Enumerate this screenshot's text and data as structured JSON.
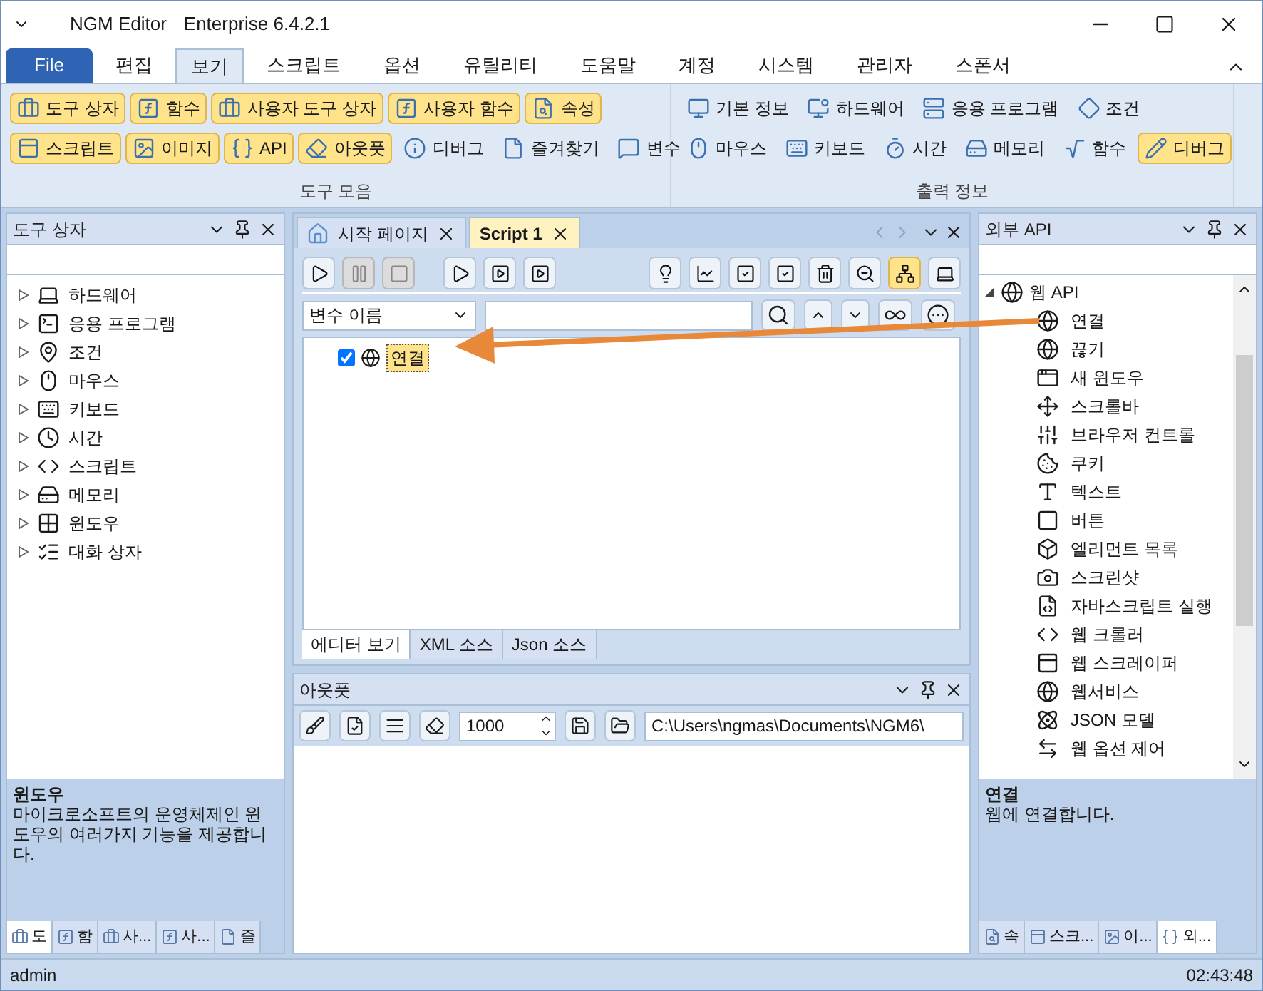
{
  "window": {
    "title": "NGM Editor",
    "edition": "Enterprise 6.4.2.1"
  },
  "menu_tabs": [
    {
      "label": "File",
      "kind": "file",
      "selected": false
    },
    {
      "label": "편집",
      "kind": "tab",
      "selected": false
    },
    {
      "label": "보기",
      "kind": "tab",
      "selected": true
    },
    {
      "label": "스크립트",
      "kind": "tab",
      "selected": false
    },
    {
      "label": "옵션",
      "kind": "tab",
      "selected": false
    },
    {
      "label": "유틸리티",
      "kind": "tab",
      "selected": false
    },
    {
      "label": "도움말",
      "kind": "tab",
      "selected": false
    },
    {
      "label": "계정",
      "kind": "tab",
      "selected": false
    },
    {
      "label": "시스템",
      "kind": "tab",
      "selected": false
    },
    {
      "label": "관리자",
      "kind": "tab",
      "selected": false
    },
    {
      "label": "스폰서",
      "kind": "tab",
      "selected": false
    }
  ],
  "ribbon": {
    "groups": [
      {
        "title": "도구 모음",
        "rows": [
          {
            "items": [
              {
                "label": "도구 상자",
                "active": true
              },
              {
                "label": "함수",
                "active": true
              },
              {
                "label": "사용자 도구 상자",
                "active": true
              },
              {
                "label": "사용자 함수",
                "active": true
              },
              {
                "label": "속성",
                "active": true
              }
            ]
          },
          {
            "items": [
              {
                "label": "스크립트",
                "active": true
              },
              {
                "label": "이미지",
                "active": true
              },
              {
                "label": "API",
                "active": true
              },
              {
                "label": "아웃풋",
                "active": true
              },
              {
                "label": "디버그",
                "active": false
              },
              {
                "label": "즐겨찾기",
                "active": false
              },
              {
                "label": "변수",
                "active": false
              }
            ]
          }
        ]
      },
      {
        "title": "출력 정보",
        "rows": [
          {
            "items": [
              {
                "label": "기본 정보",
                "active": false
              },
              {
                "label": "하드웨어",
                "active": false
              },
              {
                "label": "응용 프로그램",
                "active": false
              },
              {
                "label": "조건",
                "active": false
              }
            ]
          },
          {
            "items": [
              {
                "label": "마우스",
                "active": false
              },
              {
                "label": "키보드",
                "active": false
              },
              {
                "label": "시간",
                "active": false
              },
              {
                "label": "메모리",
                "active": false
              },
              {
                "label": "함수",
                "active": false
              },
              {
                "label": "디버그",
                "active": true
              }
            ]
          }
        ]
      }
    ]
  },
  "toolbox": {
    "title": "도구 상자",
    "items": [
      {
        "label": "하드웨어",
        "expanded": false
      },
      {
        "label": "응용 프로그램",
        "expanded": false
      },
      {
        "label": "조건",
        "expanded": false
      },
      {
        "label": "마우스",
        "expanded": false
      },
      {
        "label": "키보드",
        "expanded": false
      },
      {
        "label": "시간",
        "expanded": false
      },
      {
        "label": "스크립트",
        "expanded": false
      },
      {
        "label": "메모리",
        "expanded": false
      },
      {
        "label": "윈도우",
        "expanded": false
      },
      {
        "label": "대화 상자",
        "expanded": false
      }
    ],
    "description": {
      "title": "윈도우",
      "text": "마이크로소프트의 운영체제인 윈도우의 여러가지 기능을 제공합니다."
    },
    "tabs": [
      {
        "label": "도",
        "selected": true
      },
      {
        "label": "함",
        "selected": false
      },
      {
        "label": "사...",
        "selected": false
      },
      {
        "label": "사...",
        "selected": false
      },
      {
        "label": "즐",
        "selected": false
      }
    ]
  },
  "editor": {
    "tabs": [
      {
        "label": "시작 페이지",
        "selected": false
      },
      {
        "label": "Script 1",
        "selected": true
      }
    ],
    "toolbar": [
      {
        "disabled": false,
        "active": false
      },
      {
        "disabled": true,
        "active": false
      },
      {
        "disabled": true,
        "active": false
      },
      {
        "disabled": false,
        "active": false
      },
      {
        "disabled": false,
        "active": false
      },
      {
        "disabled": false,
        "active": false
      },
      {
        "disabled": false,
        "active": false
      },
      {
        "disabled": false,
        "active": false
      },
      {
        "disabled": false,
        "active": false
      },
      {
        "disabled": false,
        "active": false
      },
      {
        "disabled": false,
        "active": false
      },
      {
        "disabled": false,
        "active": false
      },
      {
        "disabled": false,
        "active": true
      },
      {
        "disabled": false,
        "active": false
      }
    ],
    "filter": {
      "value": "변수 이름"
    },
    "tree": [
      {
        "label": "연결",
        "checked": true,
        "selected": true
      }
    ],
    "view_tabs": [
      {
        "label": "에디터 보기",
        "selected": true
      },
      {
        "label": "XML 소스",
        "selected": false
      },
      {
        "label": "Json 소스",
        "selected": false
      }
    ]
  },
  "output": {
    "title": "아웃풋",
    "count": "1000",
    "path": "C:\\Users\\ngmas\\Documents\\NGM6\\"
  },
  "external_api": {
    "title": "외부 API",
    "tree": [
      {
        "label": "웹 API",
        "expanded": true,
        "children": [
          {
            "label": "연결"
          },
          {
            "label": "끊기"
          },
          {
            "label": "새 윈도우"
          },
          {
            "label": "스크롤바"
          },
          {
            "label": "브라우저 컨트롤"
          },
          {
            "label": "쿠키"
          },
          {
            "label": "텍스트"
          },
          {
            "label": "버튼"
          },
          {
            "label": "엘리먼트 목록"
          },
          {
            "label": "스크린샷"
          },
          {
            "label": "자바스크립트 실행"
          },
          {
            "label": "웹 크롤러"
          },
          {
            "label": "웹 스크레이퍼"
          },
          {
            "label": "웹서비스"
          },
          {
            "label": "JSON 모델"
          },
          {
            "label": "웹 옵션 제어"
          }
        ]
      }
    ],
    "description": {
      "title": "연결",
      "text": "웹에 연결합니다."
    },
    "tabs": [
      {
        "label": "속",
        "selected": false
      },
      {
        "label": "스크...",
        "selected": false
      },
      {
        "label": "이...",
        "selected": false
      },
      {
        "label": "외...",
        "selected": true
      }
    ]
  },
  "status_bar": {
    "user": "admin",
    "time": "02:43:48"
  }
}
